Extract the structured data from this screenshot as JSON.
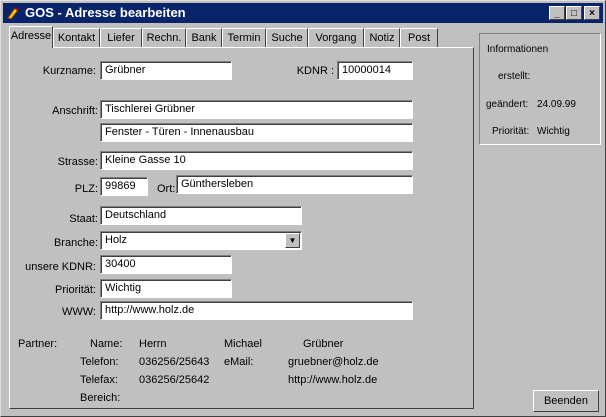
{
  "window": {
    "title": "GOS - Adresse bearbeiten"
  },
  "titlebar_buttons": {
    "minimize": "_",
    "maximize": "□",
    "close": "×"
  },
  "tabs": [
    "Adresse",
    "Kontakt",
    "Liefer",
    "Rechn.",
    "Bank",
    "Termin",
    "Suche",
    "Vorgang",
    "Notiz",
    "Post"
  ],
  "form": {
    "kurzname_label": "Kurzname:",
    "kurzname": "Grübner",
    "kdnr_label": "KDNR :",
    "kdnr": "10000014",
    "anschrift_label": "Anschrift:",
    "anschrift1": "Tischlerei Grübner",
    "anschrift2": "Fenster - Türen - Innenausbau",
    "strasse_label": "Strasse:",
    "strasse": "Kleine Gasse 10",
    "plz_label": "PLZ:",
    "plz": "99869",
    "ort_label": "Ort:",
    "ort": "Günthersleben",
    "staat_label": "Staat:",
    "staat": "Deutschland",
    "branche_label": "Branche:",
    "branche": "Holz",
    "unsere_kdnr_label": "unsere KDNR:",
    "unsere_kdnr": "30400",
    "prioritaet_label": "Priorität:",
    "prioritaet": "Wichtig",
    "www_label": "WWW:",
    "www": "http://www.holz.de"
  },
  "partner": {
    "label": "Partner:",
    "name_label": "Name:",
    "salutation": "Herrn",
    "firstname": "Michael",
    "lastname": "Grübner",
    "telefon_label": "Telefon:",
    "telefon": "036256/25643",
    "email_label": "eMail:",
    "email": "gruebner@holz.de",
    "telefax_label": "Telefax:",
    "telefax": "036256/25642",
    "web": "http://www.holz.de",
    "bereich_label": "Bereich:"
  },
  "info": {
    "title": "Informationen",
    "erstellt_label": "erstellt:",
    "geaendert_label": "geändert:",
    "geaendert": "24.09.99",
    "prioritaet_label": "Priorität:",
    "prioritaet": "Wichtig"
  },
  "buttons": {
    "beenden": "Beenden"
  }
}
